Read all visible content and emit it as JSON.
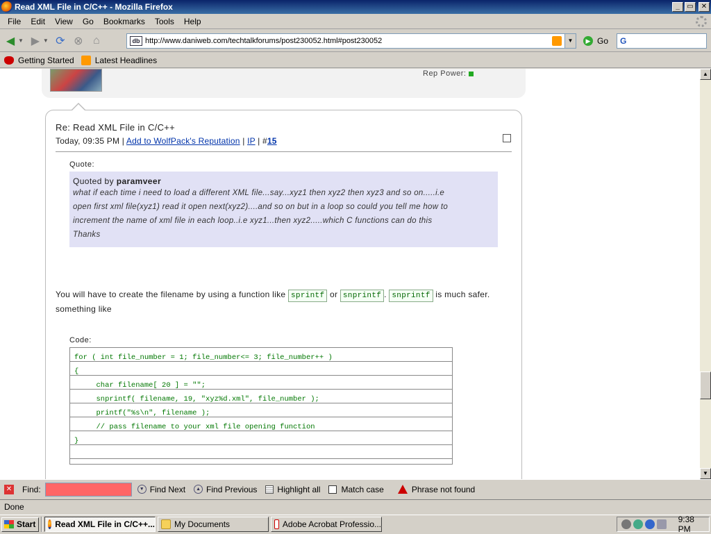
{
  "window": {
    "title": "Read XML File in C/C++ - Mozilla Firefox",
    "controls": {
      "minimize": "_",
      "maximize": "▭",
      "close": "✕"
    }
  },
  "menu": {
    "items": [
      "File",
      "Edit",
      "View",
      "Go",
      "Bookmarks",
      "Tools",
      "Help"
    ]
  },
  "nav": {
    "url": "http://www.daniweb.com/techtalkforums/post230052.html#post230052",
    "site_icon": "db",
    "go_label": "Go",
    "search_placeholder": ""
  },
  "bookmarks": {
    "items": [
      "Getting Started",
      "Latest Headlines"
    ]
  },
  "previous_post": {
    "rep_label": "Rep Power:"
  },
  "post": {
    "title": "Re: Read XML File in C/C++",
    "time": "Today, 09:35 PM",
    "rep_link": "Add to WolfPack's Reputation",
    "ip_link": "IP",
    "post_number_prefix": "#",
    "post_number": "15",
    "quote_label": "Quote:",
    "quote_by_prefix": "Quoted by",
    "quote_author": "paramveer",
    "quote_lines": [
      "what if each time i need to load a different XML file...say...xyz1 then xyz2 then xyz3 and so on.....i.e",
      "open first xml file(xyz1) read it open next(xyz2)....and so on but in a loop so could you tell me how to",
      "increment the name of xml file in each loop..i.e xyz1...then xyz2.....which C functions can do this",
      "Thanks"
    ],
    "body_part1": "You will have to create the filename by using a function like",
    "func1": "sprintf",
    "body_or": "or",
    "func2": "snprintf",
    "body_dot": ".",
    "func3": "snprintf",
    "body_part2": "is much safer.",
    "body_line2": "something like",
    "code_label": "Code:",
    "code_lines": [
      "for ( int file_number = 1; file_number<= 3; file_number++ )",
      "{",
      "     char filename[ 20 ] = \"\";",
      "     snprintf( filename, 19, \"xyz%d.xml\", file_number );",
      "     printf(\"%s\\n\", filename );",
      "     // pass filename to your xml file opening function",
      "}",
      ""
    ]
  },
  "findbar": {
    "label": "Find:",
    "value": "",
    "find_next": "Find Next",
    "find_previous": "Find Previous",
    "highlight_all": "Highlight all",
    "match_case": "Match case",
    "status": "Phrase not found"
  },
  "status": {
    "text": "Done"
  },
  "taskbar": {
    "start": "Start",
    "tasks": [
      "Read XML File in C/C++...",
      "My Documents",
      "Adobe Acrobat Professio..."
    ],
    "clock": "9:38 PM"
  },
  "colors": {
    "titlebar": "#0a246a",
    "link": "#0033aa",
    "quote_bg": "#e1e1f5",
    "code_text": "#007700",
    "find_input_error": "#ff6666"
  }
}
